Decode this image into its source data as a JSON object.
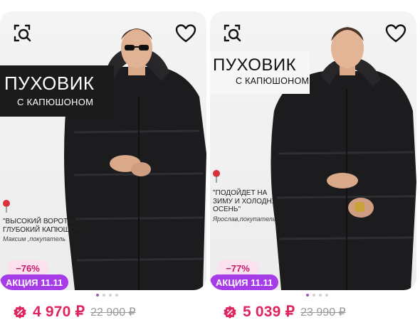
{
  "products": [
    {
      "banner_title": "ПУХОВИК",
      "banner_subtitle": "С КАПЮШОНОМ",
      "review_text": "\"ВЫСОКИЙ ВОРОТНИК, ГЛУБОКИЙ КАПЮШОН\"",
      "review_author": "Максим ,покупатель",
      "discount": "−76%",
      "promo": "АКЦИЯ 11.11",
      "price": "4 970 ₽",
      "old_price": "22 900 ₽"
    },
    {
      "banner_title": "ПУХОВИК",
      "banner_subtitle": "С КАПЮШОНОМ",
      "review_text": "\"ПОДОЙДЕТ НА ЗИМУ И ХОЛОДНУЮ ОСЕНЬ\"",
      "review_author": "Ярослав,покупатель",
      "discount": "−77%",
      "promo": "АКЦИЯ 11.11",
      "price": "5 039 ₽",
      "old_price": "23 990 ₽"
    }
  ],
  "colors": {
    "price": "#e0245e",
    "promo_bg": "#a63be8",
    "discount_bg": "#fbe0ee",
    "jacket": "#1c1c1e"
  },
  "icons": [
    "similar-search-icon",
    "heart-icon",
    "discount-badge-icon",
    "pin-icon"
  ]
}
